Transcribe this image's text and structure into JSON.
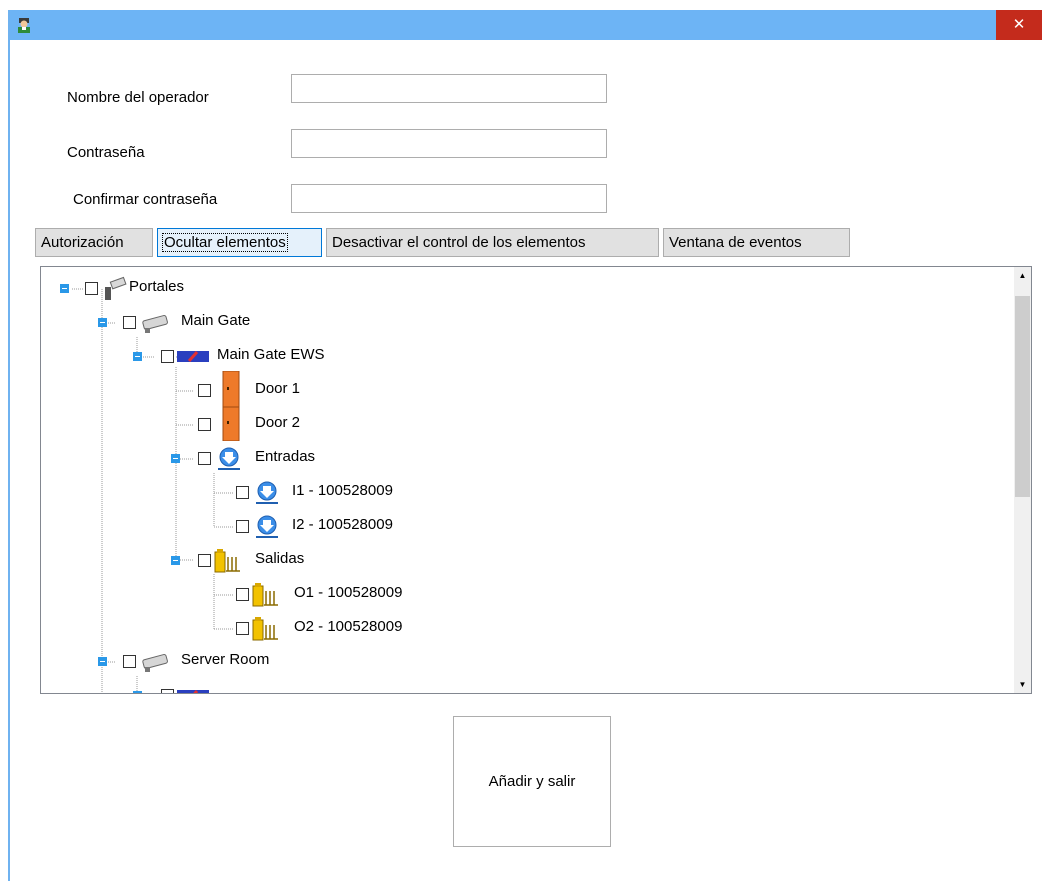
{
  "window": {
    "close_glyph": "✕",
    "icon": "operator-avatar-icon"
  },
  "form": {
    "operator_name_label": "Nombre del operador",
    "password_label": "Contraseña",
    "confirm_password_label": "Confirmar contraseña",
    "operator_name_value": "",
    "password_value": "",
    "confirm_password_value": ""
  },
  "tabs": [
    {
      "label": "Autorización",
      "selected": false
    },
    {
      "label": "Ocultar elementos",
      "selected": true
    },
    {
      "label": "Desactivar el control de los elementos",
      "selected": false
    },
    {
      "label": "Ventana de eventos",
      "selected": false
    }
  ],
  "tree": {
    "nodes": [
      {
        "label": "Portales",
        "icon": "portal-camera-icon",
        "expanded": true,
        "checked": false
      },
      {
        "label": "Main Gate",
        "icon": "camera-icon",
        "expanded": true,
        "checked": false
      },
      {
        "label": "Main Gate EWS",
        "icon": "ews-controller-icon",
        "expanded": true,
        "checked": false
      },
      {
        "label": "Door 1",
        "icon": "door-icon",
        "checked": false
      },
      {
        "label": "Door 2",
        "icon": "door-icon",
        "checked": false
      },
      {
        "label": "Entradas",
        "icon": "input-arrow-icon",
        "expanded": true,
        "checked": false
      },
      {
        "label": "I1 - 100528009",
        "icon": "input-arrow-icon",
        "checked": false
      },
      {
        "label": "I2 - 100528009",
        "icon": "input-arrow-icon",
        "checked": false
      },
      {
        "label": "Salidas",
        "icon": "output-gate-icon",
        "expanded": true,
        "checked": false
      },
      {
        "label": "O1 - 100528009",
        "icon": "output-gate-icon",
        "checked": false
      },
      {
        "label": "O2 - 100528009",
        "icon": "output-gate-icon",
        "checked": false
      },
      {
        "label": "Server Room",
        "icon": "camera-icon",
        "expanded": true,
        "checked": false
      }
    ]
  },
  "submit_label": "Añadir y salir",
  "colors": {
    "titlebar": "#6db4f5",
    "close": "#c42b1c",
    "expander": "#2a98e8"
  }
}
